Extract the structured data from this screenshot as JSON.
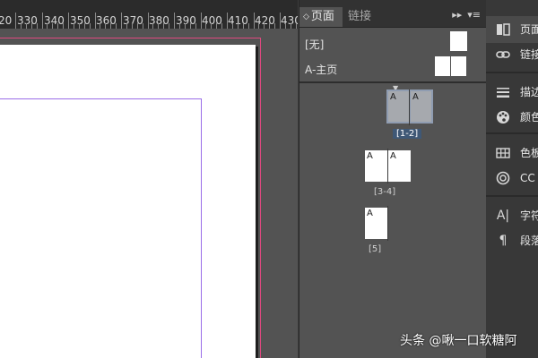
{
  "ruler": {
    "labels": [
      "20",
      "330",
      "340",
      "350",
      "360",
      "370",
      "380",
      "390",
      "400",
      "410",
      "420",
      "430"
    ]
  },
  "pages_panel": {
    "tabs": [
      {
        "label": "页面",
        "active": true
      },
      {
        "label": "链接",
        "active": false
      }
    ],
    "menu_icon": "fast-forward-icon",
    "masters": [
      {
        "label": "[无]"
      },
      {
        "label": "A-主页"
      }
    ],
    "spreads": [
      {
        "label": "[1-2]",
        "selected": true,
        "pages": [
          "A",
          "A"
        ]
      },
      {
        "label": "[3-4]",
        "selected": false,
        "pages": [
          "A",
          "A"
        ]
      },
      {
        "label": "[5]",
        "selected": false,
        "pages": [
          "A"
        ]
      }
    ]
  },
  "dock": {
    "items": [
      {
        "label": "页面",
        "icon": "pages-icon"
      },
      {
        "label": "链接",
        "icon": "link-icon"
      },
      {
        "label": "描边",
        "icon": "stroke-icon"
      },
      {
        "label": "颜色",
        "icon": "palette-icon"
      },
      {
        "label": "色板",
        "icon": "swatches-icon"
      },
      {
        "label": "CC",
        "icon": "creative-cloud-icon"
      },
      {
        "label": "字符",
        "icon": "character-icon"
      },
      {
        "label": "段落",
        "icon": "paragraph-icon"
      }
    ]
  },
  "watermark": {
    "text": "头条 @啾一口软糖阿"
  },
  "colors": {
    "bleed": "#e0487f",
    "margin_guide": "#9a6de8",
    "selection": "#3f5876"
  }
}
